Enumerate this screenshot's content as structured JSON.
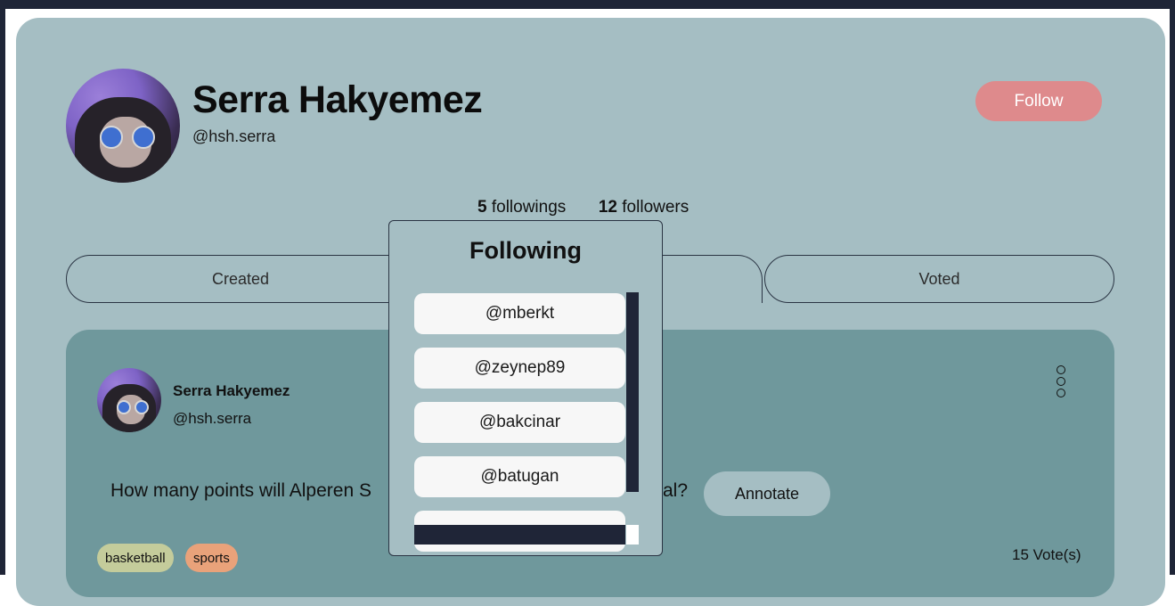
{
  "profile": {
    "name": "Serra Hakyemez",
    "handle": "@hsh.serra",
    "follow_label": "Follow",
    "followings_count": "5",
    "followings_label": "followings",
    "followers_count": "12",
    "followers_label": "followers"
  },
  "tabs": [
    {
      "label": "Created"
    },
    {
      "label": "Voted"
    }
  ],
  "post": {
    "author_name": "Serra Hakyemez",
    "author_handle": "@hsh.serra",
    "question_visible_start": "How many points will Alperen S",
    "question_visible_end": "al?",
    "annotate_label": "Annotate",
    "tags": [
      "basketball",
      "sports"
    ],
    "votes": "15 Vote(s)"
  },
  "following_modal": {
    "title": "Following",
    "items": [
      "@mberkt",
      "@zeynep89",
      "@bakcinar",
      "@batugan",
      ""
    ]
  },
  "colors": {
    "card_bg": "#a5bec3",
    "post_bg": "#6f989c",
    "follow_button": "#de8a8c",
    "tag_basketball": "#c4cc9b",
    "tag_sports": "#e9a27a",
    "dark_frame": "#1f2537"
  },
  "icons": {
    "menu": "more-options-icon"
  }
}
